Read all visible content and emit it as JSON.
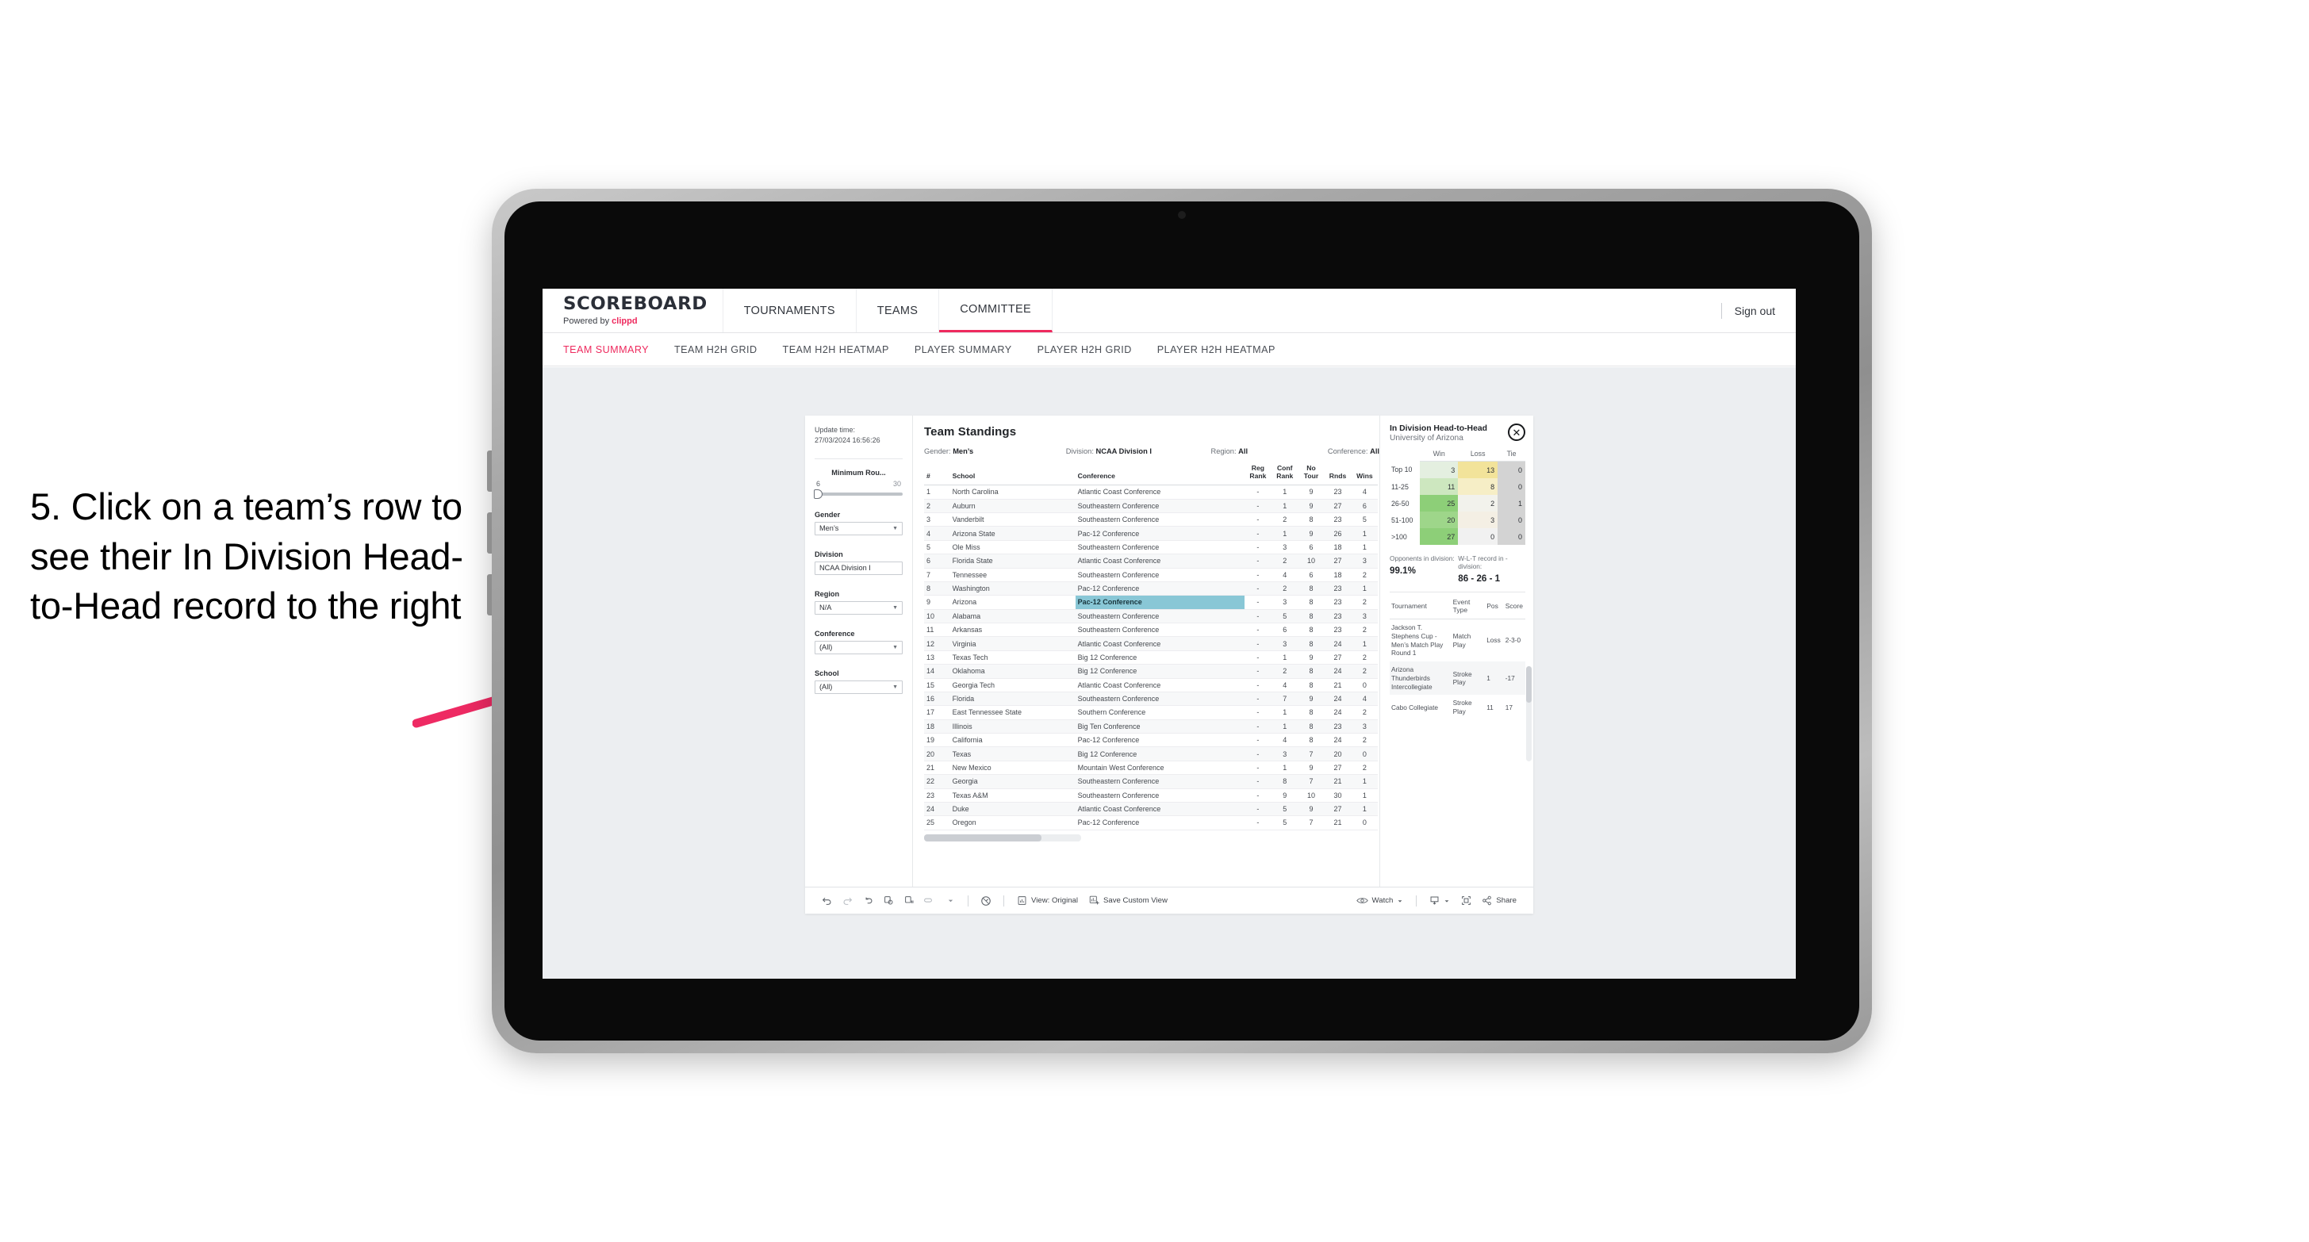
{
  "annotation": {
    "text": "5. Click on a team’s row to see their In Division Head-to-Head record to the right",
    "arrow_color": "#ee2a63"
  },
  "topnav": {
    "brand_title": "SCOREBOARD",
    "brand_sub_prefix": "Powered by ",
    "brand_sub_name": "clippd",
    "items": [
      {
        "label": "TOURNAMENTS",
        "active": false
      },
      {
        "label": "TEAMS",
        "active": false
      },
      {
        "label": "COMMITTEE",
        "active": true
      }
    ],
    "signout_label": "Sign out"
  },
  "subnav": {
    "items": [
      {
        "label": "TEAM SUMMARY",
        "active": true
      },
      {
        "label": "TEAM H2H GRID",
        "active": false
      },
      {
        "label": "TEAM H2H HEATMAP",
        "active": false
      },
      {
        "label": "PLAYER SUMMARY",
        "active": false
      },
      {
        "label": "PLAYER H2H GRID",
        "active": false
      },
      {
        "label": "PLAYER H2H HEATMAP",
        "active": false
      }
    ]
  },
  "filters": {
    "update_time_label": "Update time:",
    "update_time_value": "27/03/2024 16:56:26",
    "min_rounds": {
      "label": "Minimum Rou...",
      "min": "6",
      "max": "30"
    },
    "groups": [
      {
        "label": "Gender",
        "value": "Men’s"
      },
      {
        "label": "Division",
        "value": "NCAA Division I"
      },
      {
        "label": "Region",
        "value": "N/A"
      },
      {
        "label": "Conference",
        "value": "(All)"
      },
      {
        "label": "School",
        "value": "(All)"
      }
    ]
  },
  "standings": {
    "title": "Team Standings",
    "applied_filters": [
      {
        "label": "Gender:",
        "value": "Men’s"
      },
      {
        "label": "Division:",
        "value": "NCAA Division I"
      },
      {
        "label": "Region:",
        "value": "All"
      },
      {
        "label": "Conference:",
        "value": "All"
      }
    ],
    "columns": [
      "#",
      "School",
      "Conference",
      "Reg Rank",
      "Conf Rank",
      "No Tour",
      "Rnds",
      "Wins"
    ],
    "selected_row_rank": "9",
    "rows": [
      {
        "rank": "1",
        "school": "North Carolina",
        "conference": "Atlantic Coast Conference",
        "reg_rank": "-",
        "conf_rank": "1",
        "no_tour": "9",
        "rnds": "23",
        "wins": "4"
      },
      {
        "rank": "2",
        "school": "Auburn",
        "conference": "Southeastern Conference",
        "reg_rank": "-",
        "conf_rank": "1",
        "no_tour": "9",
        "rnds": "27",
        "wins": "6"
      },
      {
        "rank": "3",
        "school": "Vanderbilt",
        "conference": "Southeastern Conference",
        "reg_rank": "-",
        "conf_rank": "2",
        "no_tour": "8",
        "rnds": "23",
        "wins": "5"
      },
      {
        "rank": "4",
        "school": "Arizona State",
        "conference": "Pac-12 Conference",
        "reg_rank": "-",
        "conf_rank": "1",
        "no_tour": "9",
        "rnds": "26",
        "wins": "1"
      },
      {
        "rank": "5",
        "school": "Ole Miss",
        "conference": "Southeastern Conference",
        "reg_rank": "-",
        "conf_rank": "3",
        "no_tour": "6",
        "rnds": "18",
        "wins": "1"
      },
      {
        "rank": "6",
        "school": "Florida State",
        "conference": "Atlantic Coast Conference",
        "reg_rank": "-",
        "conf_rank": "2",
        "no_tour": "10",
        "rnds": "27",
        "wins": "3"
      },
      {
        "rank": "7",
        "school": "Tennessee",
        "conference": "Southeastern Conference",
        "reg_rank": "-",
        "conf_rank": "4",
        "no_tour": "6",
        "rnds": "18",
        "wins": "2"
      },
      {
        "rank": "8",
        "school": "Washington",
        "conference": "Pac-12 Conference",
        "reg_rank": "-",
        "conf_rank": "2",
        "no_tour": "8",
        "rnds": "23",
        "wins": "1"
      },
      {
        "rank": "9",
        "school": "Arizona",
        "conference": "Pac-12 Conference",
        "reg_rank": "-",
        "conf_rank": "3",
        "no_tour": "8",
        "rnds": "23",
        "wins": "2"
      },
      {
        "rank": "10",
        "school": "Alabama",
        "conference": "Southeastern Conference",
        "reg_rank": "-",
        "conf_rank": "5",
        "no_tour": "8",
        "rnds": "23",
        "wins": "3"
      },
      {
        "rank": "11",
        "school": "Arkansas",
        "conference": "Southeastern Conference",
        "reg_rank": "-",
        "conf_rank": "6",
        "no_tour": "8",
        "rnds": "23",
        "wins": "2"
      },
      {
        "rank": "12",
        "school": "Virginia",
        "conference": "Atlantic Coast Conference",
        "reg_rank": "-",
        "conf_rank": "3",
        "no_tour": "8",
        "rnds": "24",
        "wins": "1"
      },
      {
        "rank": "13",
        "school": "Texas Tech",
        "conference": "Big 12 Conference",
        "reg_rank": "-",
        "conf_rank": "1",
        "no_tour": "9",
        "rnds": "27",
        "wins": "2"
      },
      {
        "rank": "14",
        "school": "Oklahoma",
        "conference": "Big 12 Conference",
        "reg_rank": "-",
        "conf_rank": "2",
        "no_tour": "8",
        "rnds": "24",
        "wins": "2"
      },
      {
        "rank": "15",
        "school": "Georgia Tech",
        "conference": "Atlantic Coast Conference",
        "reg_rank": "-",
        "conf_rank": "4",
        "no_tour": "8",
        "rnds": "21",
        "wins": "0"
      },
      {
        "rank": "16",
        "school": "Florida",
        "conference": "Southeastern Conference",
        "reg_rank": "-",
        "conf_rank": "7",
        "no_tour": "9",
        "rnds": "24",
        "wins": "4"
      },
      {
        "rank": "17",
        "school": "East Tennessee State",
        "conference": "Southern Conference",
        "reg_rank": "-",
        "conf_rank": "1",
        "no_tour": "8",
        "rnds": "24",
        "wins": "2"
      },
      {
        "rank": "18",
        "school": "Illinois",
        "conference": "Big Ten Conference",
        "reg_rank": "-",
        "conf_rank": "1",
        "no_tour": "8",
        "rnds": "23",
        "wins": "3"
      },
      {
        "rank": "19",
        "school": "California",
        "conference": "Pac-12 Conference",
        "reg_rank": "-",
        "conf_rank": "4",
        "no_tour": "8",
        "rnds": "24",
        "wins": "2"
      },
      {
        "rank": "20",
        "school": "Texas",
        "conference": "Big 12 Conference",
        "reg_rank": "-",
        "conf_rank": "3",
        "no_tour": "7",
        "rnds": "20",
        "wins": "0"
      },
      {
        "rank": "21",
        "school": "New Mexico",
        "conference": "Mountain West Conference",
        "reg_rank": "-",
        "conf_rank": "1",
        "no_tour": "9",
        "rnds": "27",
        "wins": "2"
      },
      {
        "rank": "22",
        "school": "Georgia",
        "conference": "Southeastern Conference",
        "reg_rank": "-",
        "conf_rank": "8",
        "no_tour": "7",
        "rnds": "21",
        "wins": "1"
      },
      {
        "rank": "23",
        "school": "Texas A&M",
        "conference": "Southeastern Conference",
        "reg_rank": "-",
        "conf_rank": "9",
        "no_tour": "10",
        "rnds": "30",
        "wins": "1"
      },
      {
        "rank": "24",
        "school": "Duke",
        "conference": "Atlantic Coast Conference",
        "reg_rank": "-",
        "conf_rank": "5",
        "no_tour": "9",
        "rnds": "27",
        "wins": "1"
      },
      {
        "rank": "25",
        "school": "Oregon",
        "conference": "Pac-12 Conference",
        "reg_rank": "-",
        "conf_rank": "5",
        "no_tour": "7",
        "rnds": "21",
        "wins": "0"
      }
    ]
  },
  "h2h": {
    "title": "In Division Head-to-Head",
    "subtitle": "University of Arizona",
    "close_icon": "✕",
    "matrix": {
      "columns": [
        "Win",
        "Loss",
        "Tie"
      ],
      "rows": [
        {
          "label": "Top 10",
          "win": "3",
          "loss": "13",
          "tie": "0",
          "win_color": "#e4efe0",
          "loss_color": "#f2e39a",
          "tie_color": "#d3d3d3"
        },
        {
          "label": "11-25",
          "win": "11",
          "loss": "8",
          "tie": "0",
          "win_color": "#cde7bf",
          "loss_color": "#f6eec6",
          "tie_color": "#d3d3d3"
        },
        {
          "label": "26-50",
          "win": "25",
          "loss": "2",
          "tie": "1",
          "win_color": "#8dcf78",
          "loss_color": "#f2f2ec",
          "tie_color": "#d3d3d3"
        },
        {
          "label": "51-100",
          "win": "20",
          "loss": "3",
          "tie": "0",
          "win_color": "#9ed68a",
          "loss_color": "#f4efe4",
          "tie_color": "#d3d3d3"
        },
        {
          "label": ">100",
          "win": "27",
          "loss": "0",
          "tie": "0",
          "win_color": "#8dcf78",
          "loss_color": "#f1f1f1",
          "tie_color": "#d3d3d3"
        }
      ]
    },
    "stats": [
      {
        "label": "Opponents in division:",
        "value": "99.1%"
      },
      {
        "label": "W-L-T record in -division:",
        "value": "86 - 26 - 1"
      }
    ],
    "tournaments": {
      "columns": [
        "Tournament",
        "Event Type",
        "Pos",
        "Score"
      ],
      "rows": [
        {
          "name": "Jackson T. Stephens Cup - Men’s Match Play Round 1",
          "type": "Match Play",
          "pos": "Loss",
          "score": "2-3-0"
        },
        {
          "name": "Arizona Thunderbirds Intercollegiate",
          "type": "Stroke Play",
          "pos": "1",
          "score": "-17"
        },
        {
          "name": "Cabo Collegiate",
          "type": "Stroke Play",
          "pos": "11",
          "score": "17"
        }
      ]
    }
  },
  "toolbar": {
    "icons": [
      "undo-icon",
      "redo-icon",
      "revert-icon",
      "refresh-data-icon",
      "pause-updates-icon",
      "alert-icon"
    ],
    "view_label": "View: Original",
    "save_view_label": "Save Custom View",
    "watch_label": "Watch",
    "share_label": "Share"
  }
}
